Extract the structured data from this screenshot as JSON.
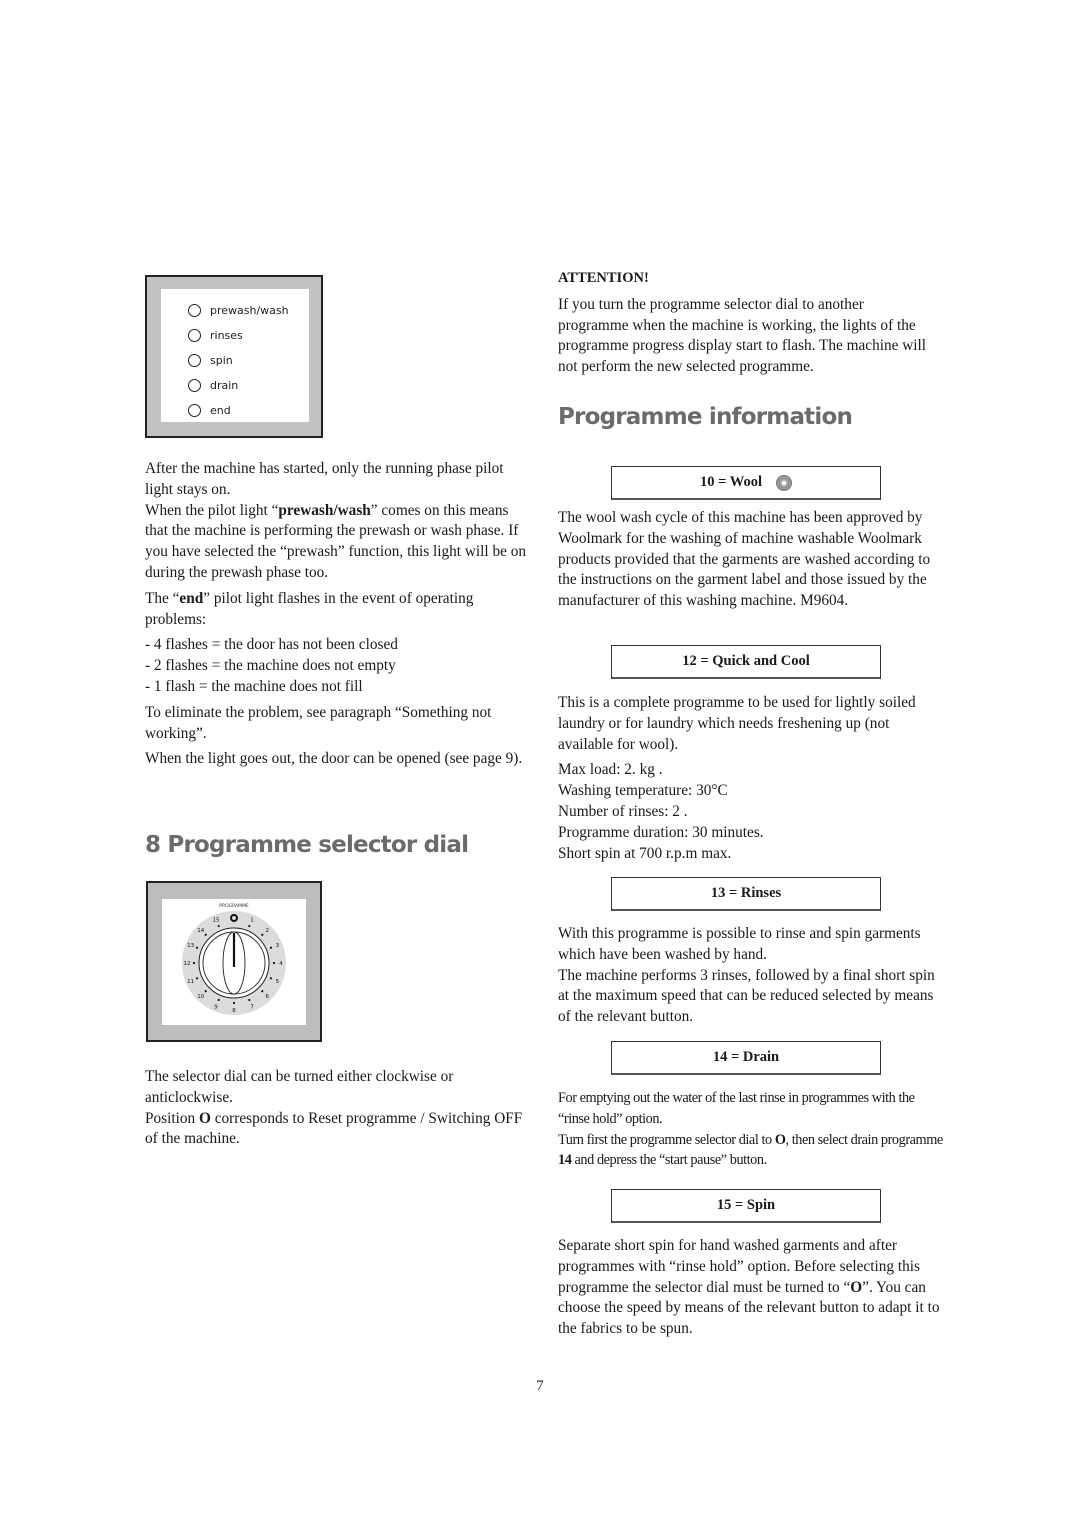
{
  "left_column": {
    "pilot_lights": [
      {
        "label": "prewash/wash",
        "icon": "pilot-light-circle-icon"
      },
      {
        "label": "rinses",
        "icon": "pilot-light-circle-icon"
      },
      {
        "label": "spin",
        "icon": "pilot-light-circle-icon"
      },
      {
        "label": "drain",
        "icon": "pilot-light-circle-icon"
      },
      {
        "label": "end",
        "icon": "pilot-light-circle-icon"
      }
    ],
    "para1": {
      "a": "After the machine has started, only the running phase pilot light stays on.",
      "b_pre": "When the pilot light “",
      "b_bold": "prewash/wash",
      "b_post": "” comes on this means that the machine is performing the prewash or wash phase. If you have selected the “prewash” function, this light will be on during the prewash phase too."
    },
    "para2": {
      "pre": "The “",
      "bold": "end",
      "post": "” pilot light flashes in the event of operating problems:"
    },
    "flash_list": [
      "- 4 flashes = the door has not been closed",
      "- 2 flashes = the machine does not empty",
      "- 1 flash = the machine does not fill"
    ],
    "para3": "To eliminate the problem, see paragraph “Something not working”.",
    "para4": "When the light goes out, the door can be opened (see page 9).",
    "section_heading": "8 Programme selector dial",
    "dial": {
      "label": "PROGRAMME",
      "off_marker": "O",
      "positions": [
        "1",
        "2",
        "3",
        "4",
        "5",
        "6",
        "7",
        "8",
        "9",
        "10",
        "11",
        "12",
        "13",
        "14",
        "15"
      ]
    },
    "para5": "The selector dial can be turned either clockwise or anticlockwise.",
    "para6": {
      "pre": "Position ",
      "bold": "O",
      "post": " corresponds to Reset programme / Switching OFF of the machine."
    }
  },
  "right_column": {
    "attention": {
      "title": "ATTENTION!",
      "text": "If you turn the programme selector dial to another programme when the machine is working, the lights of the programme progress display start to flash. The machine will not perform the new selected programme."
    },
    "section_heading": "Programme information",
    "programmes": {
      "wool": {
        "title": "10 = Wool",
        "icon": "woolmark-icon",
        "text": "The wool wash cycle of this machine has been approved by Woolmark for the washing of machine washable Woolmark products provided that the garments are washed according to the instructions on the garment label and those issued by the manufacturer of this washing machine. M9604."
      },
      "quick": {
        "title": "12 = Quick and Cool",
        "text": "This is a complete programme to be used for lightly soiled laundry or for laundry which needs freshening up (not available for wool).",
        "specs": [
          "Max load: 2. kg .",
          "Washing temperature: 30°C",
          "Number of rinses: 2 .",
          "Programme duration: 30 minutes.",
          "Short spin at 700 r.p.m max."
        ]
      },
      "rinses": {
        "title": "13 = Rinses",
        "text_a": "With this programme is possible to rinse and spin garments which have been washed by hand.",
        "text_b": "The machine performs 3 rinses, followed by a final short spin at the maximum speed that can be reduced selected by means of the relevant button."
      },
      "drain": {
        "title": "14 = Drain",
        "text_a": "For emptying out the water of the last rinse in programmes with the “rinse hold” option.",
        "text_b_pre": "Turn first the programme selector dial to ",
        "text_b_bold1": "O",
        "text_b_mid": ", then select drain programme ",
        "text_b_bold2": "14",
        "text_b_post": " and depress the “start pause” button."
      },
      "spin": {
        "title": "15 = Spin",
        "text_pre": "Separate short spin for hand washed garments and after programmes with “rinse hold” option. Before selecting this programme the selector dial must be turned to “",
        "text_bold": "O",
        "text_post": "”. You can choose the speed by means of the relevant button to adapt it to the fabrics to be spun."
      }
    }
  },
  "page_number": "7"
}
